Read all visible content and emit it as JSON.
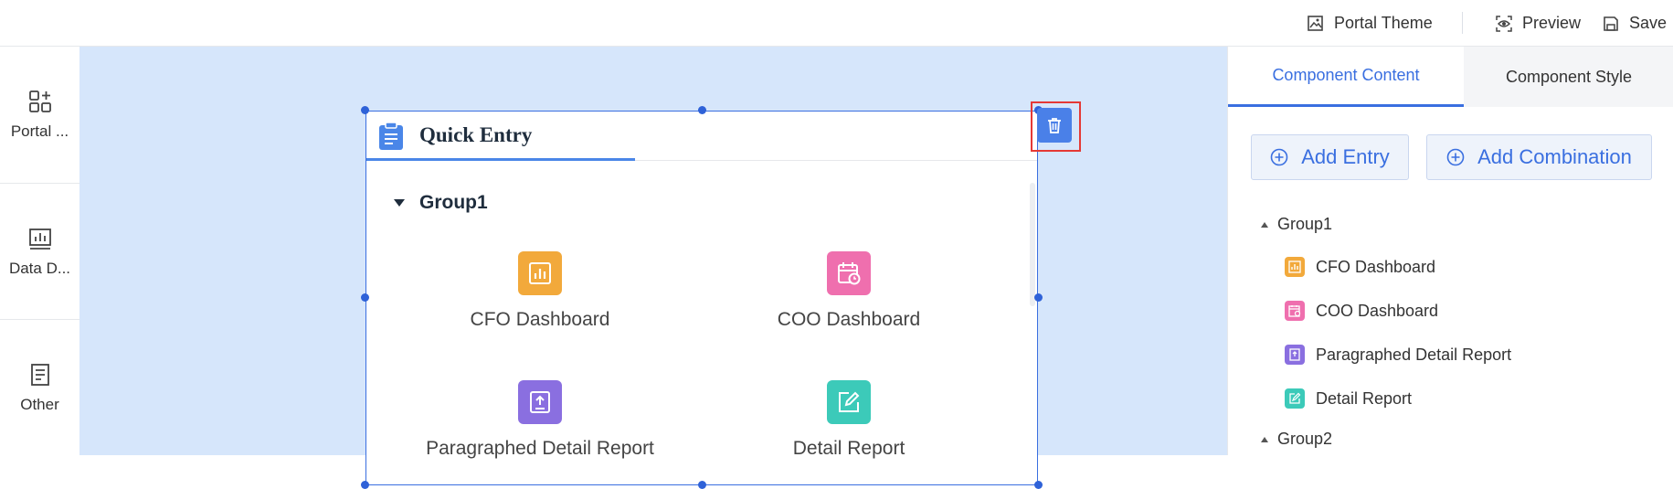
{
  "topbar": {
    "portal_theme": "Portal Theme",
    "preview": "Preview",
    "save": "Save"
  },
  "sidebar": {
    "items": [
      {
        "label": "Portal ...",
        "icon": "components-add-icon"
      },
      {
        "label": "Data D...",
        "icon": "chart-board-icon"
      },
      {
        "label": "Other",
        "icon": "document-icon"
      }
    ]
  },
  "widget": {
    "title": "Quick Entry",
    "group": "Group1",
    "entries": [
      {
        "label": "CFO Dashboard",
        "icon": "bar-chart-icon",
        "color": "#f2a93b"
      },
      {
        "label": "COO Dashboard",
        "icon": "calendar-clock-icon",
        "color": "#ef6fae"
      },
      {
        "label": "Paragraphed Detail Report",
        "icon": "upload-report-icon",
        "color": "#8a6fe0"
      },
      {
        "label": "Detail Report",
        "icon": "edit-icon",
        "color": "#3ccab9"
      }
    ]
  },
  "right_panel": {
    "tabs": [
      "Component Content",
      "Component Style"
    ],
    "add_entry": "Add Entry",
    "add_combination": "Add Combination",
    "tree": {
      "group1": "Group1",
      "items": [
        {
          "label": "CFO Dashboard",
          "color": "#f2a93b"
        },
        {
          "label": "COO Dashboard",
          "color": "#ef6fae"
        },
        {
          "label": "Paragraphed Detail Report",
          "color": "#8a6fe0"
        },
        {
          "label": "Detail Report",
          "color": "#3ccab9"
        }
      ],
      "group2": "Group2"
    }
  },
  "colors": {
    "accent": "#3a6fe0",
    "canvas": "#d6e6fb",
    "highlight": "#e53935"
  }
}
